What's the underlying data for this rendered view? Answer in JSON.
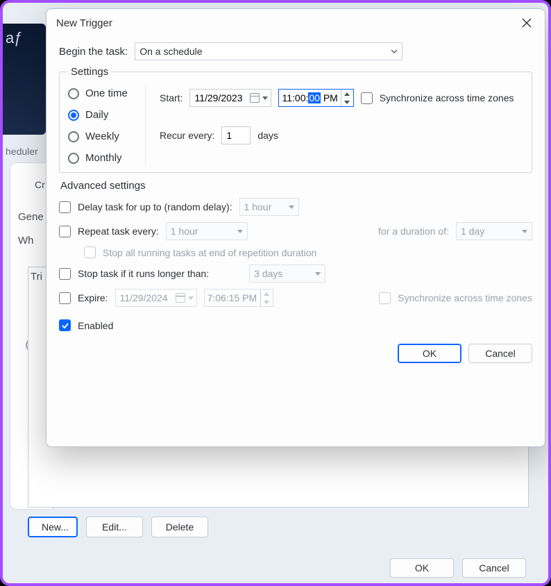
{
  "dialog": {
    "title": "New Trigger",
    "begin_label": "Begin the task:",
    "begin_value": "On a schedule"
  },
  "settings": {
    "legend": "Settings",
    "freq": {
      "one_time": "One time",
      "daily": "Daily",
      "weekly": "Weekly",
      "monthly": "Monthly",
      "selected": "daily"
    },
    "start_label": "Start:",
    "start_date": "11/29/2023",
    "start_time_h": "11",
    "start_time_m": "00",
    "start_time_s": "00",
    "start_time_ampm": "PM",
    "sync_tz": "Synchronize across time zones",
    "recur_label": "Recur every:",
    "recur_value": "1",
    "recur_unit": "days"
  },
  "advanced": {
    "legend": "Advanced settings",
    "delay_label": "Delay task for up to (random delay):",
    "delay_value": "1 hour",
    "repeat_label": "Repeat task every:",
    "repeat_value": "1 hour",
    "duration_label": "for a duration of:",
    "duration_value": "1 day",
    "stopall_label": "Stop all running tasks at end of repetition duration",
    "stop_label": "Stop task if it runs longer than:",
    "stop_value": "3 days",
    "expire_label": "Expire:",
    "expire_date": "11/29/2024",
    "expire_time": "7:06:15 PM",
    "sync_tz2": "Synchronize across time zones",
    "enabled_label": "Enabled"
  },
  "buttons": {
    "ok": "OK",
    "cancel": "Cancel"
  },
  "behind": {
    "scheduler": "heduler",
    "dark_text": "aƒ",
    "cc": "Cr",
    "gene": "Gene",
    "wh": "Wh",
    "tri": "Tri",
    "new": "New...",
    "edit": "Edit...",
    "delete": "Delete",
    "ok": "OK",
    "cancel": "Cancel"
  }
}
